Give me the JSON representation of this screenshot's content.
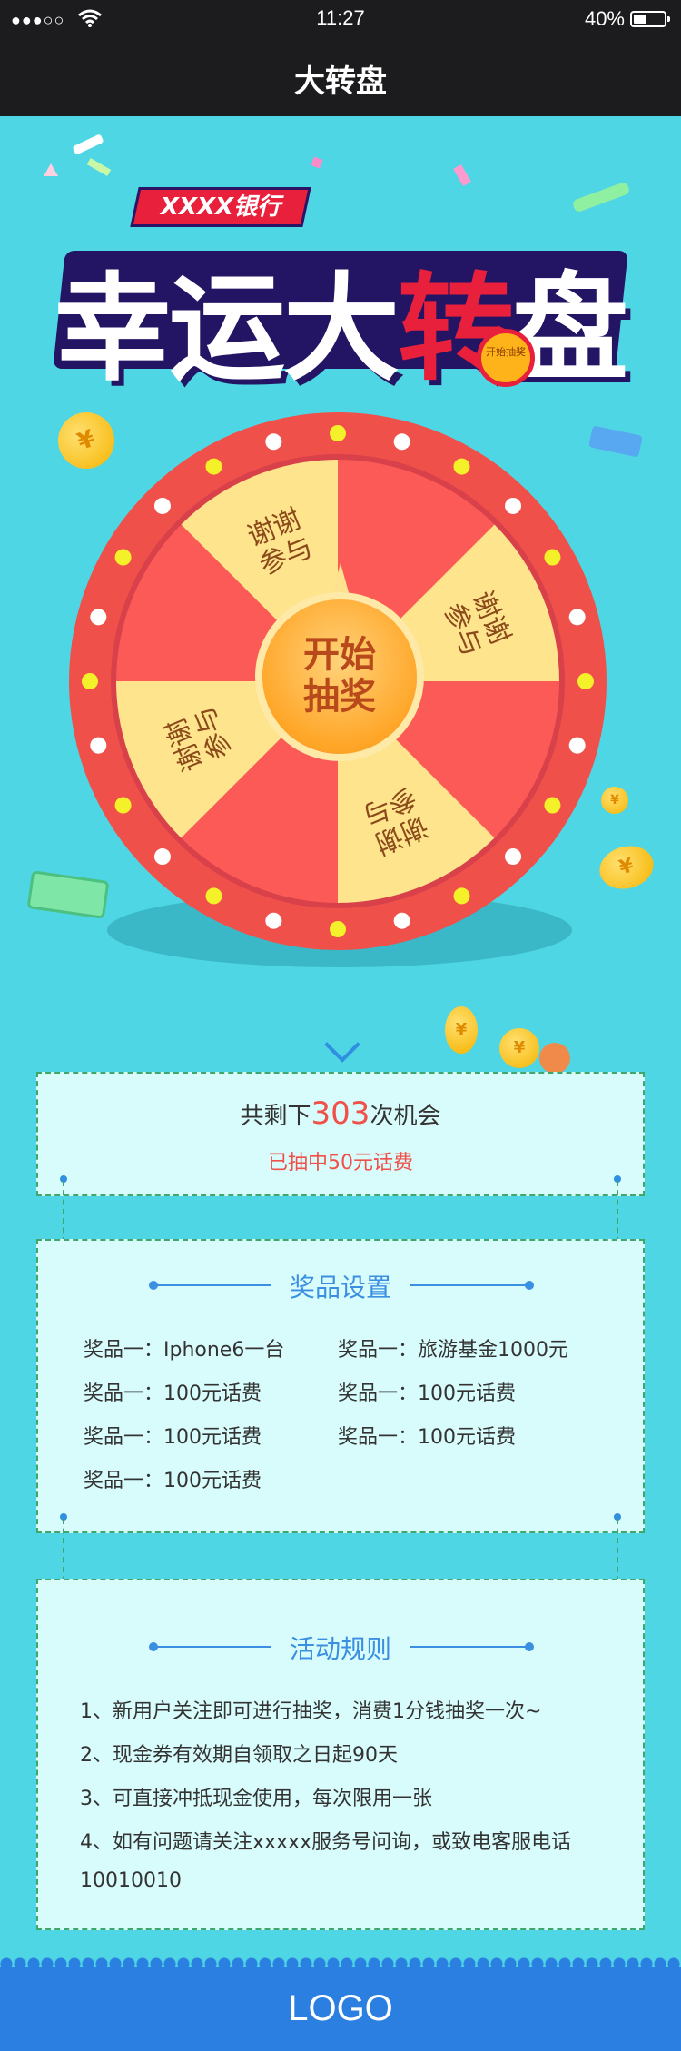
{
  "status_bar": {
    "signal": "●●●○○",
    "time": "11:27",
    "battery": "40%",
    "battery_level": 0.4
  },
  "nav": {
    "title": "大转盘"
  },
  "banner": {
    "tag": "XXXX银行",
    "title_parts": [
      "幸运大",
      "转",
      "盘"
    ],
    "badge": "开始抽奖"
  },
  "wheel": {
    "segments": [
      "谢谢参与",
      "",
      "谢谢参与",
      "",
      "谢谢参与",
      "",
      "谢谢参与",
      ""
    ],
    "colors": {
      "rim": "#f0504a",
      "slice_yellow": "#ffe48e",
      "slice_red": "#fb5a56",
      "bulb_white": "#ffffff",
      "bulb_yellow": "#f4f02a"
    },
    "start_line1": "开始",
    "start_line2": "抽奖"
  },
  "chances": {
    "prefix": "共剩下",
    "count": "303",
    "suffix": "次机会",
    "won": "已抽中50元话费"
  },
  "prizes": {
    "title": "奖品设置",
    "items": [
      "奖品一：Iphone6一台",
      "奖品一：旅游基金1000元",
      "奖品一：100元话费",
      "奖品一：100元话费",
      "奖品一：100元话费",
      "奖品一：100元话费",
      "奖品一：100元话费"
    ]
  },
  "rules": {
    "title": "活动规则",
    "items": [
      "1、新用户关注即可进行抽奖，消费1分钱抽奖一次~",
      "2、现金券有效期自领取之日起90天",
      "3、可直接冲抵现金使用，每次限用一张",
      "4、如有问题请关注xxxxx服务号问询，或致电客服电话",
      "10010010"
    ]
  },
  "footer": {
    "logo": "LOGO"
  }
}
